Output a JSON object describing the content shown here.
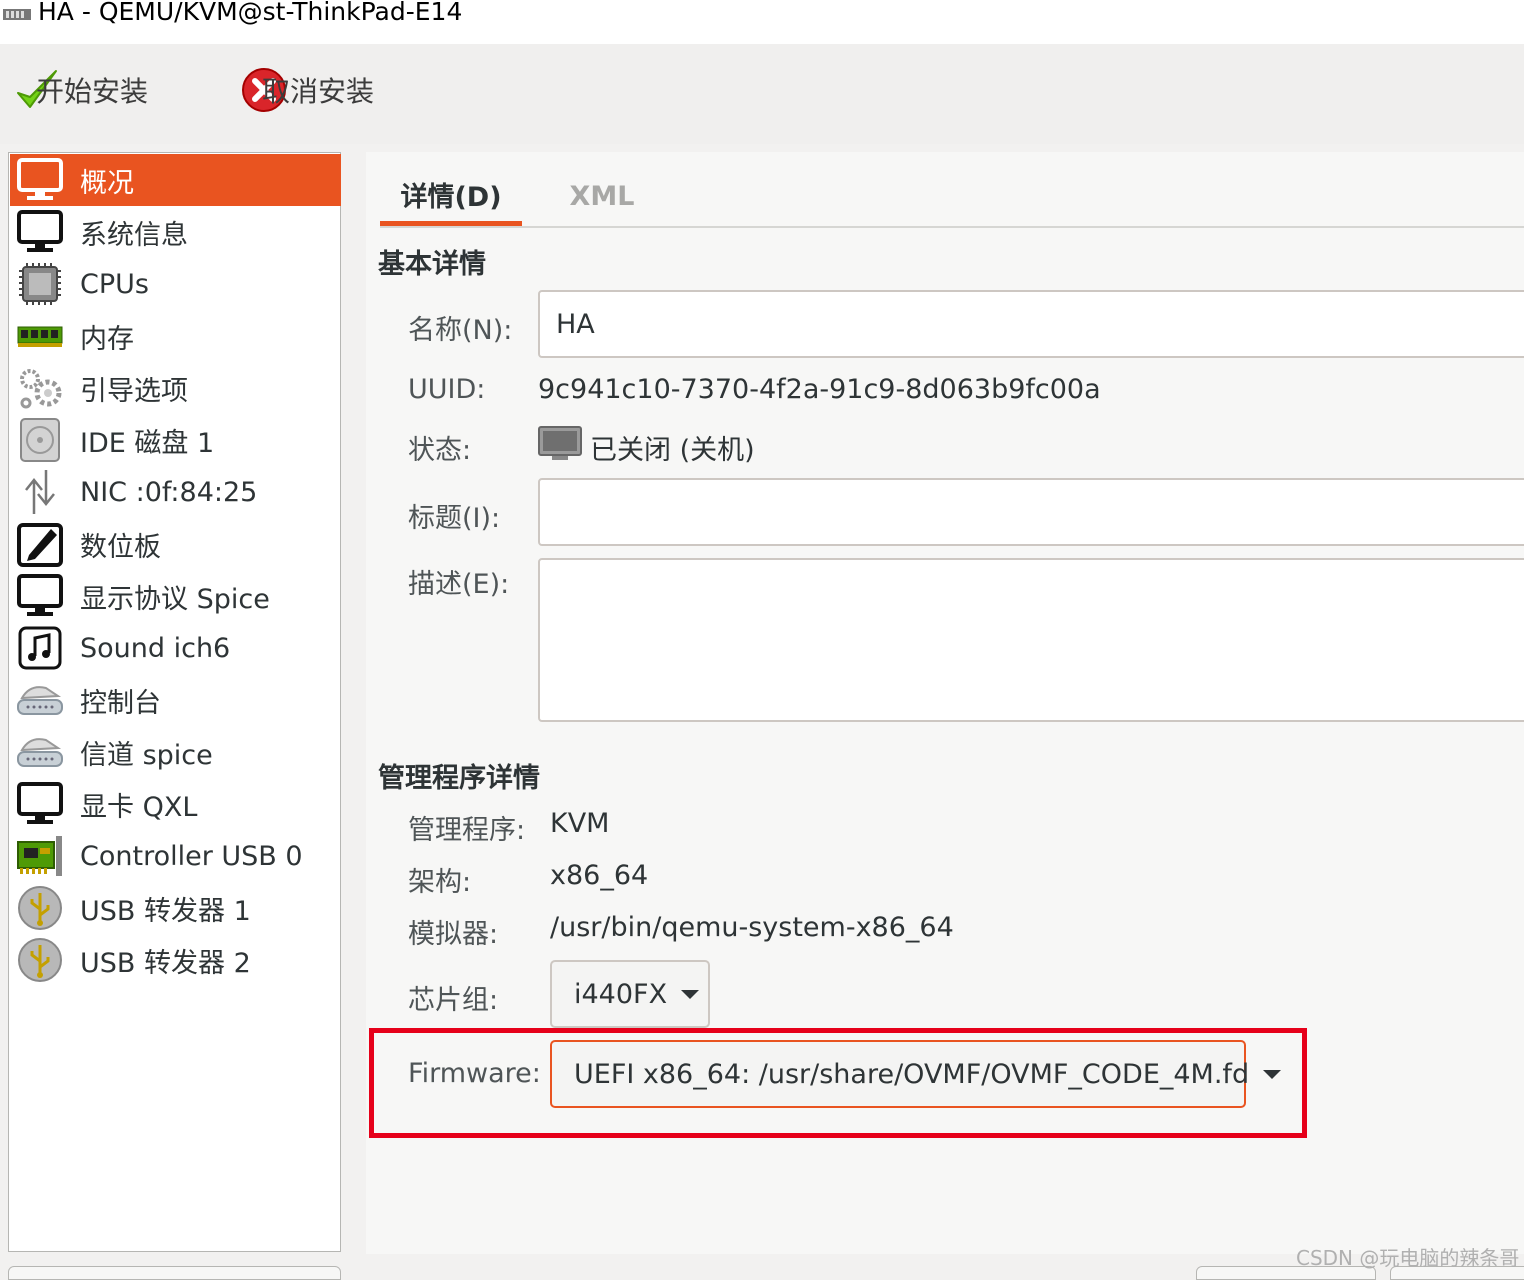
{
  "window": {
    "title": "HA - QEMU/KVM@st-ThinkPad-E14"
  },
  "toolbar": {
    "begin_install": "开始安装",
    "cancel_install": "取消安装"
  },
  "sidebar": {
    "items": [
      {
        "label": "概况",
        "icon": "monitor-icon",
        "selected": true
      },
      {
        "label": "系统信息",
        "icon": "monitor-icon"
      },
      {
        "label": "CPUs",
        "icon": "cpu-chip-icon"
      },
      {
        "label": "内存",
        "icon": "memory-module-icon"
      },
      {
        "label": "引导选项",
        "icon": "gears-icon"
      },
      {
        "label": "IDE 磁盘 1",
        "icon": "disk-icon"
      },
      {
        "label": "NIC :0f:84:25",
        "icon": "network-arrows-icon"
      },
      {
        "label": "数位板",
        "icon": "tablet-pen-icon"
      },
      {
        "label": "显示协议 Spice",
        "icon": "monitor-icon"
      },
      {
        "label": "Sound ich6",
        "icon": "music-note-icon"
      },
      {
        "label": "控制台",
        "icon": "serial-port-icon"
      },
      {
        "label": "信道 spice",
        "icon": "serial-port-icon"
      },
      {
        "label": "显卡 QXL",
        "icon": "monitor-icon"
      },
      {
        "label": "Controller USB 0",
        "icon": "pci-card-icon"
      },
      {
        "label": "USB 转发器 1",
        "icon": "usb-icon"
      },
      {
        "label": "USB 转发器 2",
        "icon": "usb-icon"
      }
    ]
  },
  "tabs": {
    "details": "详情(D)",
    "xml": "XML"
  },
  "basic": {
    "heading": "基本详情",
    "name_label": "名称(N):",
    "name_value": "HA",
    "uuid_label": "UUID:",
    "uuid_value": "9c941c10-7370-4f2a-91c9-8d063b9fc00a",
    "status_label": "状态:",
    "status_value": "已关闭 (关机)",
    "title_label": "标题(I):",
    "title_value": "",
    "desc_label": "描述(E):",
    "desc_value": ""
  },
  "hypervisor": {
    "heading": "管理程序详情",
    "hypervisor_label": "管理程序:",
    "hypervisor_value": "KVM",
    "arch_label": "架构:",
    "arch_value": "x86_64",
    "emulator_label": "模拟器:",
    "emulator_value": "/usr/bin/qemu-system-x86_64",
    "chipset_label": "芯片组:",
    "chipset_value": "i440FX",
    "firmware_label": "Firmware:",
    "firmware_value": "UEFI x86_64: /usr/share/OVMF/OVMF_CODE_4M.fd"
  },
  "colors": {
    "accent": "#e95420",
    "highlight": "#e6001a"
  },
  "watermark": "CSDN @玩电脑的辣条哥"
}
